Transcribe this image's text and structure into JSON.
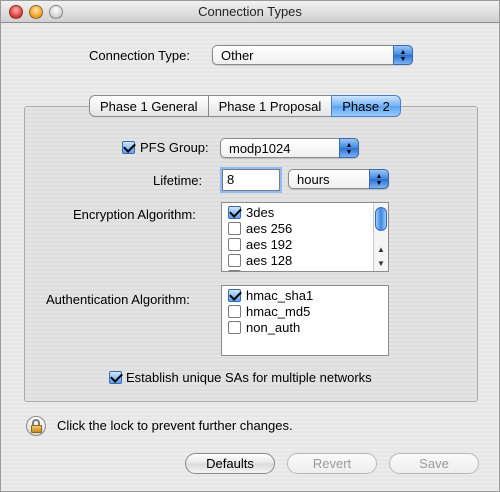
{
  "window": {
    "title": "Connection Types"
  },
  "connection_type": {
    "label": "Connection Type:",
    "value": "Other"
  },
  "tabs": [
    {
      "label": "Phase 1 General",
      "selected": false
    },
    {
      "label": "Phase 1 Proposal",
      "selected": false
    },
    {
      "label": "Phase 2",
      "selected": true
    }
  ],
  "pfs_group": {
    "label": "PFS Group:",
    "checked": true,
    "value": "modp1024"
  },
  "lifetime": {
    "label": "Lifetime:",
    "value": "8",
    "unit": "hours"
  },
  "encryption": {
    "label": "Encryption Algorithm:",
    "items": [
      {
        "label": "3des",
        "checked": true
      },
      {
        "label": "aes 256",
        "checked": false
      },
      {
        "label": "aes 192",
        "checked": false
      },
      {
        "label": "aes 128",
        "checked": false
      }
    ]
  },
  "authentication": {
    "label": "Authentication Algorithm:",
    "items": [
      {
        "label": "hmac_sha1",
        "checked": true
      },
      {
        "label": "hmac_md5",
        "checked": false
      },
      {
        "label": "non_auth",
        "checked": false
      }
    ]
  },
  "unique_sas": {
    "label": "Establish unique SAs for multiple networks",
    "checked": true
  },
  "lock": {
    "text": "Click the lock to prevent further changes."
  },
  "buttons": {
    "defaults": "Defaults",
    "revert": "Revert",
    "save": "Save"
  },
  "colors": {
    "accent": "#3d86e0",
    "selected_tab": "#74b2f6"
  }
}
